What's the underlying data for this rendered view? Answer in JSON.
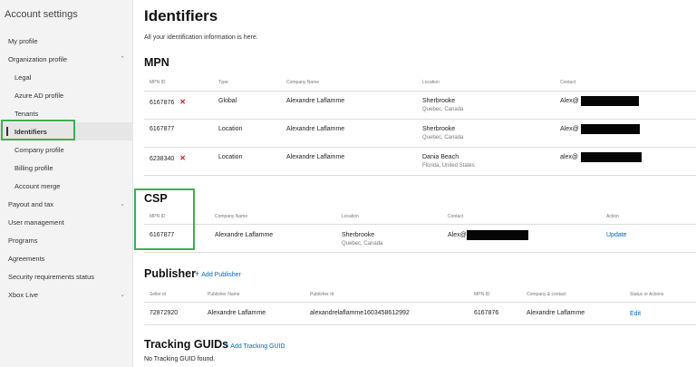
{
  "sidebar": {
    "title": "Account settings",
    "items": [
      {
        "label": "My profile",
        "chevron": ""
      },
      {
        "label": "Organization profile",
        "chevron": "^"
      },
      {
        "label": "Legal",
        "chevron": ""
      },
      {
        "label": "Azure AD profile",
        "chevron": ""
      },
      {
        "label": "Tenants",
        "chevron": ""
      },
      {
        "label": "Identifiers",
        "chevron": ""
      },
      {
        "label": "Company profile",
        "chevron": ""
      },
      {
        "label": "Billing profile",
        "chevron": ""
      },
      {
        "label": "Account merge",
        "chevron": ""
      },
      {
        "label": "Payout and tax",
        "chevron": "v"
      },
      {
        "label": "User management",
        "chevron": ""
      },
      {
        "label": "Programs",
        "chevron": ""
      },
      {
        "label": "Agreements",
        "chevron": ""
      },
      {
        "label": "Security requirements status",
        "chevron": ""
      },
      {
        "label": "Xbox Live",
        "chevron": "v"
      }
    ]
  },
  "page": {
    "title": "Identifiers",
    "subtitle": "All your identification information is here."
  },
  "mpn": {
    "title": "MPN",
    "headers": [
      "MPN ID",
      "Type",
      "Company Name",
      "Location",
      "Contact"
    ],
    "rows": [
      {
        "id": "6167876",
        "flag": "x",
        "type": "Global",
        "company": "Alexandre Laflamme",
        "city": "Sherbrooke",
        "region": "Quebec, Canada",
        "contact": "Alex@"
      },
      {
        "id": "6167877",
        "flag": "",
        "type": "Location",
        "company": "Alexandre Laflamme",
        "city": "Sherbrooke",
        "region": "Quebec, Canada",
        "contact": "Alex@"
      },
      {
        "id": "6238340",
        "flag": "x",
        "type": "Location",
        "company": "Alexandre Laflamme",
        "city": "Dania Beach",
        "region": "Florida, United States",
        "contact": "alex@"
      }
    ]
  },
  "csp": {
    "title": "CSP",
    "headers": [
      "MPN ID",
      "Company Name",
      "Location",
      "Contact",
      "Action"
    ],
    "row": {
      "id": "6167877",
      "company": "Alexandre Laflamme",
      "city": "Sherbrooke",
      "region": "Quebec, Canada",
      "contact": "Alex@",
      "action": "Update"
    }
  },
  "publisher": {
    "title": "Publisher",
    "add_label": "Add Publisher",
    "headers": [
      "Seller id",
      "Publisher Name",
      "Publisher Id",
      "MPN ID",
      "Company & contact",
      "Status or Actions"
    ],
    "row": {
      "seller_id": "72872920",
      "name": "Alexandre Laflamme",
      "publisher_id": "alexandrelaflamme1603458612992",
      "mpn_id": "6167876",
      "contact": "Alexandre Laflamme",
      "action": "Edit"
    }
  },
  "tracking": {
    "title": "Tracking GUIDs",
    "add_label": "Add Tracking GUID",
    "empty": "No Tracking GUID found."
  },
  "colors": {
    "accent": "#0067b8",
    "highlight": "#3fae50",
    "error": "#c8202a"
  },
  "icons": {
    "flag": "close-icon",
    "add": "plus-icon"
  }
}
